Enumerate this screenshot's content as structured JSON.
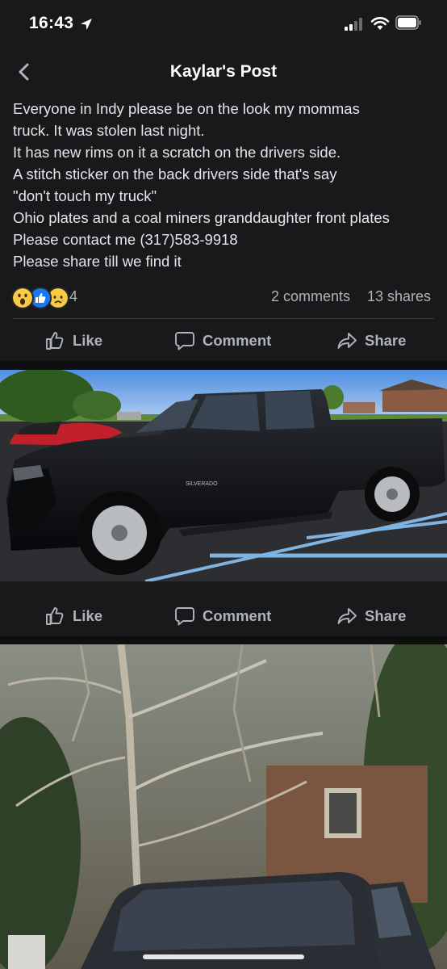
{
  "status_bar": {
    "time": "16:43"
  },
  "nav": {
    "title": "Kaylar's Post"
  },
  "post": {
    "lines": [
      "Everyone in Indy please be on the look my mommas",
      "truck. It was stolen last night.",
      "It has new rims on it a scratch on the drivers side.",
      "A stitch sticker on the back drivers side that's say",
      "\"don't touch my truck\"",
      "Ohio plates and a coal miners granddaughter front plates",
      "Please contact me (317)583-9918",
      "Please share till we find it"
    ],
    "reaction_count": "4",
    "comments": "2 comments",
    "shares": "13 shares"
  },
  "actions": {
    "like": "Like",
    "comment": "Comment",
    "share": "Share"
  },
  "colors": {
    "background": "#18191a",
    "text": "#e4e6eb",
    "secondary_text": "#b0b3b8",
    "like_blue": "#1877f2",
    "wow_yellow": "#f7c944"
  },
  "icons": [
    "back-chevron-icon",
    "location-arrow-icon",
    "wifi-icon",
    "battery-icon",
    "like-thumb-icon",
    "comment-bubble-icon",
    "share-arrow-icon"
  ]
}
